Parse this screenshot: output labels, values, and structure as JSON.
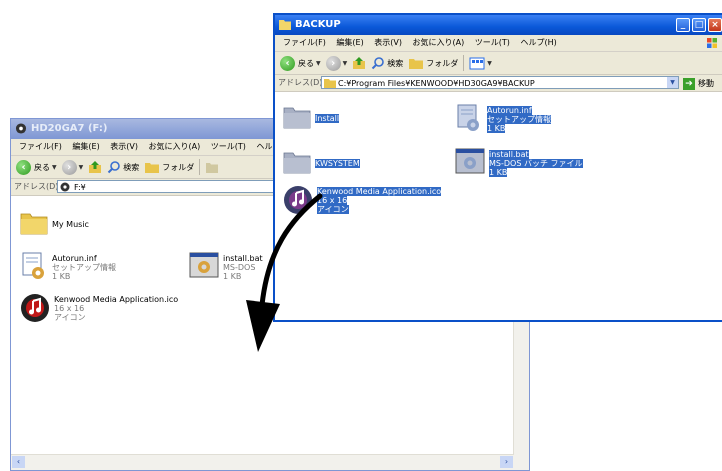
{
  "back_window": {
    "title": "HD20GA7 (F:)",
    "menu": [
      "ファイル(F)",
      "編集(E)",
      "表示(V)",
      "お気に入り(A)",
      "ツール(T)",
      "ヘルプ"
    ],
    "toolbar": {
      "back_label": "戻る",
      "search_label": "検索",
      "folders_label": "フォルダ"
    },
    "address": {
      "label": "アドレス(D)",
      "value": "F:¥"
    },
    "items": [
      {
        "name": "My Music"
      },
      {
        "name": "Autorun.inf",
        "type": "セットアップ情報",
        "size": "1 KB"
      },
      {
        "name": "install.bat",
        "type": "MS-DOS",
        "size": "1 KB"
      },
      {
        "name": "Kenwood Media Application.ico",
        "dims": "16 x 16",
        "type": "アイコン"
      }
    ]
  },
  "front_window": {
    "title": "BACKUP",
    "menu": [
      "ファイル(F)",
      "編集(E)",
      "表示(V)",
      "お気に入り(A)",
      "ツール(T)",
      "ヘルプ(H)"
    ],
    "toolbar": {
      "back_label": "戻る",
      "search_label": "検索",
      "folders_label": "フォルダ"
    },
    "address": {
      "label": "アドレス(D)",
      "value": "C:¥Program Files¥KENWOOD¥HD30GA9¥BACKUP",
      "go_label": "移動"
    },
    "items": [
      {
        "name": "Install"
      },
      {
        "name": "Autorun.inf",
        "type": "セットアップ情報",
        "size": "1 KB"
      },
      {
        "name": "KWSYSTEM"
      },
      {
        "name": "install.bat",
        "type": "MS-DOS バッチ ファイル",
        "size": "1 KB"
      },
      {
        "name": "Kenwood Media Application.ico",
        "dims": "16 x 16",
        "type": "アイコン"
      }
    ]
  },
  "colors": {
    "titlebar_active": "#0a58d8",
    "selection": "#316ac5",
    "folder": "#e8c44a",
    "arrow": "#000000"
  }
}
